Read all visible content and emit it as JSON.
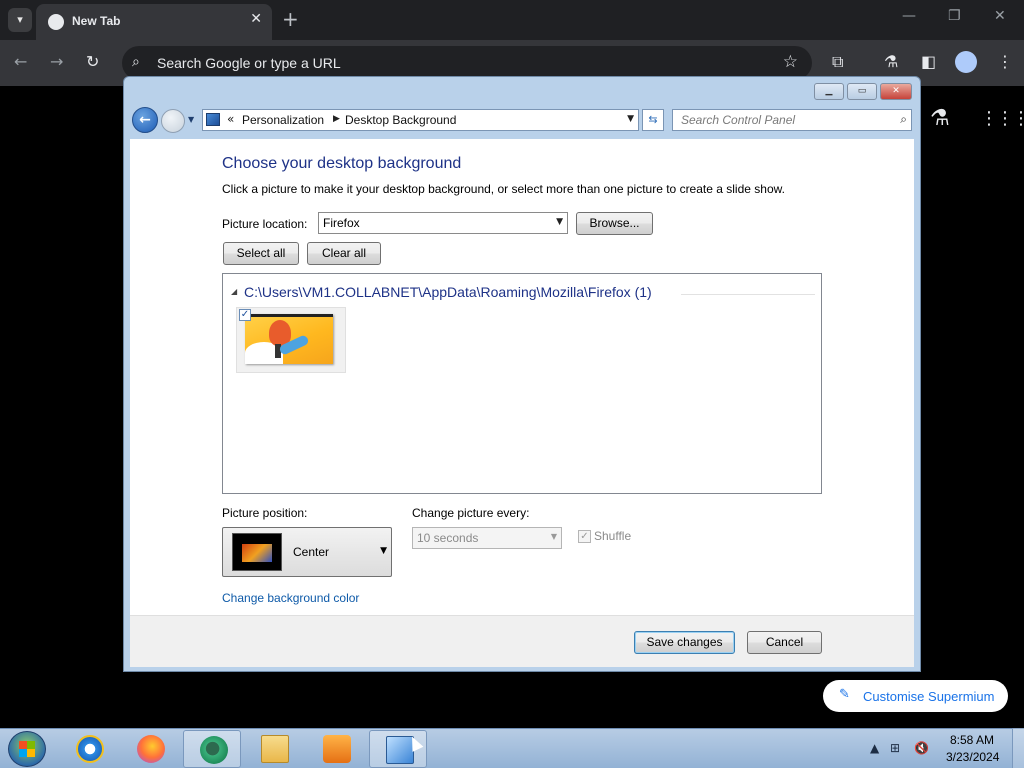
{
  "browser": {
    "tab_title": "New Tab",
    "tab_close": "✕",
    "new_tab": "+",
    "omnibox_placeholder": "Search Google or type a URL",
    "window_minimize": "—",
    "window_restore": "❐",
    "window_close": "✕"
  },
  "control_panel": {
    "breadcrumb": [
      "Personalization",
      "Desktop Background"
    ],
    "address_chevrons": "«",
    "search_placeholder": "Search Control Panel",
    "heading": "Choose your desktop background",
    "description": "Click a picture to make it your desktop background, or select more than one picture to create a slide show.",
    "picture_location_label": "Picture location:",
    "picture_location_value": "Firefox",
    "browse_label": "Browse...",
    "select_all_label": "Select all",
    "clear_all_label": "Clear all",
    "group_title": "C:\\Users\\VM1.COLLABNET\\AppData\\Roaming\\Mozilla\\Firefox (1)",
    "picture_position_label": "Picture position:",
    "picture_position_value": "Center",
    "change_picture_label": "Change picture every:",
    "change_picture_value": "10 seconds",
    "shuffle_label": "Shuffle",
    "change_bg_color_link": "Change background color",
    "save_label": "Save changes",
    "cancel_label": "Cancel"
  },
  "customise": {
    "label": "Customise Supermium"
  },
  "taskbar": {
    "time": "8:58 AM",
    "date": "3/23/2024",
    "apps": [
      "internet-explorer",
      "firefox",
      "supermium",
      "file-explorer",
      "media-player",
      "control-panel"
    ]
  }
}
